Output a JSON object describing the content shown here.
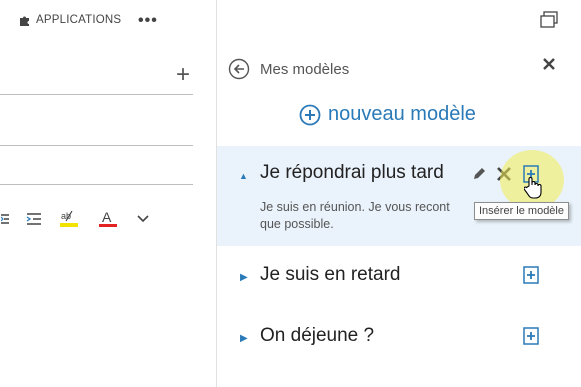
{
  "header": {
    "apps_label": "APPLICATIONS",
    "more_label": "•••"
  },
  "compose": {
    "add_label": "+",
    "format_toolbar": {
      "icons": [
        "outdent-icon",
        "indent-icon",
        "highlight-color-icon",
        "font-color-icon",
        "chevron-down-icon"
      ],
      "highlight_color": "#f2e200",
      "font_color": "#e52222"
    }
  },
  "panel": {
    "title": "Mes modèles",
    "new_template_label": "nouveau modèle",
    "accent_color": "#2a7ab8",
    "templates": [
      {
        "title": "Je répondrai plus tard",
        "expanded": true,
        "body": "Je suis en réunion. Je vous recont que possible."
      },
      {
        "title": "Je suis en retard",
        "expanded": false
      },
      {
        "title": "On déjeune ?",
        "expanded": false
      }
    ],
    "tooltip": "Insérer le modèle"
  }
}
